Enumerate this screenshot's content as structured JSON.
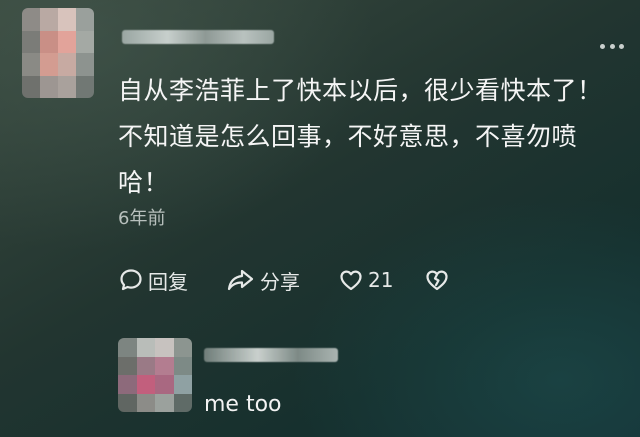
{
  "comment": {
    "username": "",
    "text_lines": [
      "自从李浩菲上了快本以后，很少看快本了！",
      "不知道是怎么回事，不好意思，不喜勿喷",
      "哈！"
    ],
    "timestamp": "6年前",
    "actions": {
      "reply_label": "回复",
      "share_label": "分享",
      "like_count": "21"
    }
  },
  "reply": {
    "username": "",
    "text": "me too"
  },
  "icons": {
    "reply": "comment-bubble-icon",
    "share": "share-arrow-icon",
    "like": "heart-icon",
    "dislike": "broken-heart-icon",
    "more": "more-dots-icon"
  }
}
